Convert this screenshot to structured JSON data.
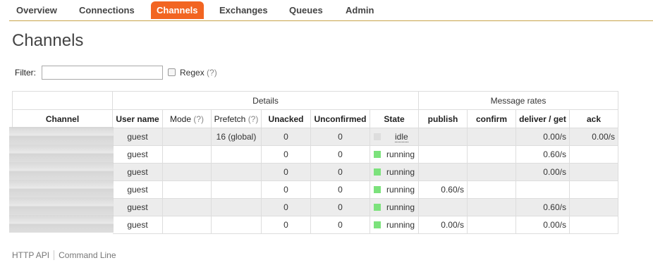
{
  "nav": {
    "items": [
      {
        "label": "Overview"
      },
      {
        "label": "Connections"
      },
      {
        "label": "Channels",
        "active": true
      },
      {
        "label": "Exchanges"
      },
      {
        "label": "Queues"
      },
      {
        "label": "Admin"
      }
    ],
    "accent_color": "#f26522",
    "rule_color": "#c8a44a"
  },
  "page": {
    "title": "Channels"
  },
  "filter": {
    "label": "Filter:",
    "value": "",
    "regex_label": "Regex",
    "regex_help": "(?)",
    "regex_checked": false
  },
  "table": {
    "group_headers": {
      "details": "Details",
      "message_rates": "Message rates"
    },
    "columns": {
      "channel": "Channel",
      "user_name": "User name",
      "mode": "Mode",
      "mode_help": "(?)",
      "prefetch": "Prefetch",
      "prefetch_help": "(?)",
      "unacked": "Unacked",
      "unconfirmed": "Unconfirmed",
      "state": "State",
      "publish": "publish",
      "confirm": "confirm",
      "deliver_get": "deliver / get",
      "ack": "ack"
    },
    "rows": [
      {
        "user": "guest",
        "mode": "",
        "prefetch": "16 (global)",
        "unacked": "0",
        "unconfirmed": "0",
        "state": "idle",
        "publish": "",
        "confirm": "",
        "deliver_get": "0.00/s",
        "ack": "0.00/s"
      },
      {
        "user": "guest",
        "mode": "",
        "prefetch": "",
        "unacked": "0",
        "unconfirmed": "0",
        "state": "running",
        "publish": "",
        "confirm": "",
        "deliver_get": "0.60/s",
        "ack": ""
      },
      {
        "user": "guest",
        "mode": "",
        "prefetch": "",
        "unacked": "0",
        "unconfirmed": "0",
        "state": "running",
        "publish": "",
        "confirm": "",
        "deliver_get": "0.00/s",
        "ack": ""
      },
      {
        "user": "guest",
        "mode": "",
        "prefetch": "",
        "unacked": "0",
        "unconfirmed": "0",
        "state": "running",
        "publish": "0.60/s",
        "confirm": "",
        "deliver_get": "",
        "ack": ""
      },
      {
        "user": "guest",
        "mode": "",
        "prefetch": "",
        "unacked": "0",
        "unconfirmed": "0",
        "state": "running",
        "publish": "",
        "confirm": "",
        "deliver_get": "0.60/s",
        "ack": ""
      },
      {
        "user": "guest",
        "mode": "",
        "prefetch": "",
        "unacked": "0",
        "unconfirmed": "0",
        "state": "running",
        "publish": "0.00/s",
        "confirm": "",
        "deliver_get": "0.00/s",
        "ack": ""
      }
    ],
    "state_colors": {
      "running": "#7ce27c",
      "idle": "#dddddd"
    }
  },
  "footer": {
    "links": [
      {
        "label": "HTTP API"
      },
      {
        "label": "Command Line"
      }
    ]
  }
}
